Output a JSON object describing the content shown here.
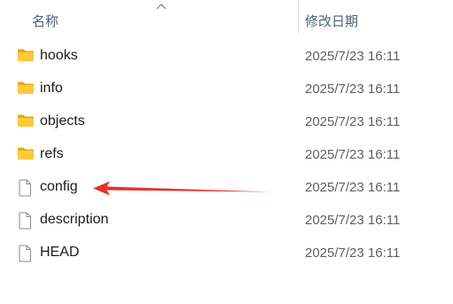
{
  "header": {
    "name_label": "名称",
    "date_label": "修改日期",
    "sort_icon": "chevron-up-icon"
  },
  "files": [
    {
      "name": "hooks",
      "type": "folder",
      "icon": "folder-icon",
      "date": "2025/7/23 16:11"
    },
    {
      "name": "info",
      "type": "folder",
      "icon": "folder-icon",
      "date": "2025/7/23 16:11"
    },
    {
      "name": "objects",
      "type": "folder",
      "icon": "folder-icon",
      "date": "2025/7/23 16:11"
    },
    {
      "name": "refs",
      "type": "folder",
      "icon": "folder-icon",
      "date": "2025/7/23 16:11"
    },
    {
      "name": "config",
      "type": "file",
      "icon": "file-icon",
      "date": "2025/7/23 16:11"
    },
    {
      "name": "description",
      "type": "file",
      "icon": "file-icon",
      "date": "2025/7/23 16:11"
    },
    {
      "name": "HEAD",
      "type": "file",
      "icon": "file-icon",
      "date": "2025/7/23 16:11"
    }
  ],
  "annotation": {
    "color": "#e8302a",
    "points_to": "config"
  },
  "colors": {
    "folder": "#ffc83d",
    "folder_back": "#e8a90c",
    "header_text": "#4c607a"
  }
}
